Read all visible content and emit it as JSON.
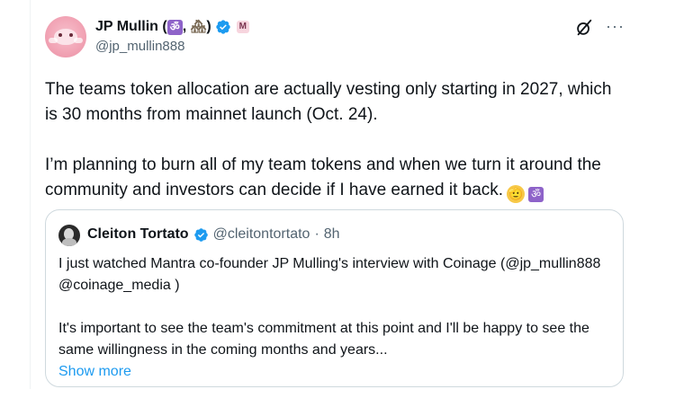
{
  "author": {
    "name": "JP Mullin (",
    "name_sep": ",",
    "name_end": ")",
    "emoji_om": "ॐ",
    "emoji_house": "🏘",
    "badge_letter": "M",
    "handle": "@jp_mullin888"
  },
  "tweet": {
    "paragraph1": "The teams token allocation are actually vesting only starting in 2027, which is 30 months from mainnet launch (Oct. 24).",
    "paragraph2": "I’m planning to burn all of my team tokens and when we turn it around the community and investors can decide if I have earned it back.",
    "emoji_salute": "🫡",
    "emoji_om": "ॐ"
  },
  "quote": {
    "name": "Cleiton Tortato",
    "handle": "@cleitontortato",
    "separator": "·",
    "time": "8h",
    "paragraph1": "I just watched Mantra co-founder JP Mulling's interview with Coinage (@jp_mullin888 @coinage_media )",
    "paragraph2": "It's important to see the team's commitment at this point and I'll be happy to see the same willingness in the coming months and years...",
    "show_more": "Show more"
  },
  "colors": {
    "verified": "#1d9bf0",
    "secondary_text": "#536471",
    "link": "#1d9bf0"
  },
  "icons": [
    "grok-icon",
    "more-icon",
    "verified-badge-icon"
  ]
}
